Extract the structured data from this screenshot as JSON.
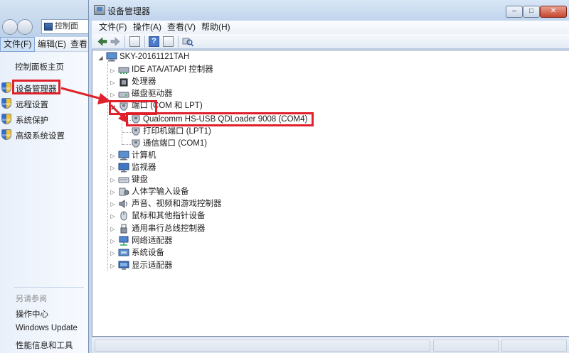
{
  "control_panel": {
    "address": "控制面",
    "menu": {
      "file": "文件(F)",
      "edit": "编辑(E)",
      "view": "查看"
    },
    "sidebar": {
      "home": "控制面板主页",
      "items": [
        "设备管理器",
        "远程设置",
        "系统保护",
        "高级系统设置"
      ],
      "see_also_title": "另请参阅",
      "see_also": [
        "操作中心",
        "Windows Update",
        "性能信息和工具"
      ]
    }
  },
  "device_manager": {
    "title": "设备管理器",
    "menu": {
      "file": "文件(F)",
      "action": "操作(A)",
      "view": "查看(V)",
      "help": "帮助(H)"
    },
    "tree": {
      "root": "SKY-20161121TAH",
      "nodes": [
        "IDE ATA/ATAPI 控制器",
        "处理器",
        "磁盘驱动器",
        "端口 (COM 和 LPT)",
        "Qualcomm HS-USB QDLoader 9008 (COM4)",
        "打印机端口 (LPT1)",
        "通信端口 (COM1)",
        "计算机",
        "监视器",
        "键盘",
        "人体学输入设备",
        "声音、视频和游戏控制器",
        "鼠标和其他指针设备",
        "通用串行总线控制器",
        "网络适配器",
        "系统设备",
        "显示适配器"
      ]
    }
  },
  "annotation_color": "#e0202a"
}
